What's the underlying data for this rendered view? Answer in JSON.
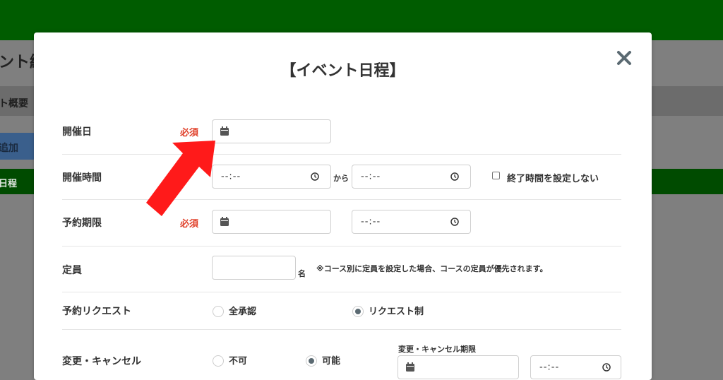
{
  "background": {
    "title": "ント編",
    "tab": "ト概要",
    "add_button": "追加",
    "section": "日程"
  },
  "modal": {
    "title": "【イベント日程】",
    "required": "必須",
    "fields": {
      "date": {
        "label": "開催日"
      },
      "time": {
        "label": "開催時間",
        "start": "--:--",
        "separator": "から",
        "end": "--:--",
        "no_end_label": "終了時間を設定しない"
      },
      "deadline": {
        "label": "予約期限",
        "time": "--:--"
      },
      "capacity": {
        "label": "定員",
        "unit": "名",
        "note": "※コース別に定員を設定した場合、コースの定員が優先されます。"
      },
      "request": {
        "label": "予約リクエスト",
        "option1": "全承認",
        "option2": "リクエスト制",
        "selected": "リクエスト制"
      },
      "change": {
        "label": "変更・キャンセル",
        "option1": "不可",
        "option2": "可能",
        "selected": "可能",
        "deadline_label": "変更・キャンセル期限",
        "deadline_time": "--:--"
      }
    }
  },
  "colors": {
    "header": "#005c00",
    "required": "#e0402a",
    "arrow": "#ff1a1a"
  },
  "icons": {
    "close": "close-icon",
    "calendar": "calendar-icon",
    "clock": "clock-icon",
    "arrow": "pointer-arrow-icon"
  }
}
